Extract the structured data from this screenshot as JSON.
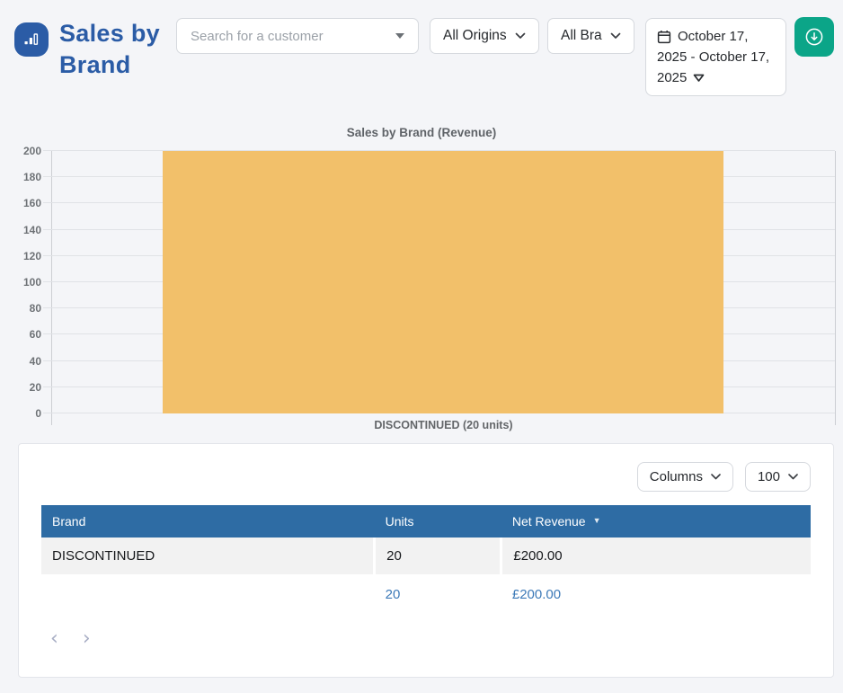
{
  "app": {
    "title": "Sales by Brand"
  },
  "header": {
    "search_placeholder": "Search for a customer",
    "origins_filter_label": "All Origins",
    "brands_filter_label": "All Bra",
    "date_range_lines": [
      "October 17,",
      "2025 - October 17,",
      "2025"
    ],
    "icons": {
      "logo": "bar-chart-icon",
      "calendar": "calendar-icon",
      "download": "download-circle-icon",
      "dropdown": "chevron-down-icon"
    }
  },
  "chart_data": {
    "type": "bar",
    "title": "Sales by Brand (Revenue)",
    "categories": [
      "DISCONTINUED (20 units)"
    ],
    "values": [
      200
    ],
    "series_name": "Revenue",
    "ylim": [
      0,
      200
    ],
    "ytick_step": 20,
    "yticks": [
      0,
      20,
      40,
      60,
      80,
      100,
      120,
      140,
      160,
      180,
      200
    ],
    "xlabel": "",
    "ylabel": "",
    "grid": true,
    "legend": false,
    "bar_color": "#f2c06a"
  },
  "table": {
    "columns_button_label": "Columns",
    "page_size_value": "100",
    "headers": [
      "Brand",
      "Units",
      "Net Revenue"
    ],
    "sort": {
      "column": "Net Revenue",
      "direction": "desc"
    },
    "rows": [
      {
        "brand": "DISCONTINUED",
        "units": "20",
        "net_revenue": "£200.00"
      }
    ],
    "totals": {
      "units": "20",
      "net_revenue": "£200.00"
    }
  },
  "colors": {
    "accent_blue": "#2b5ca6",
    "table_header_blue": "#2e6ca4",
    "bar_orange": "#f2c06a",
    "download_teal": "#0ba588",
    "totals_blue": "#3d7ab8",
    "page_background": "#f4f5f8",
    "row_gray": "#f2f2f2"
  }
}
